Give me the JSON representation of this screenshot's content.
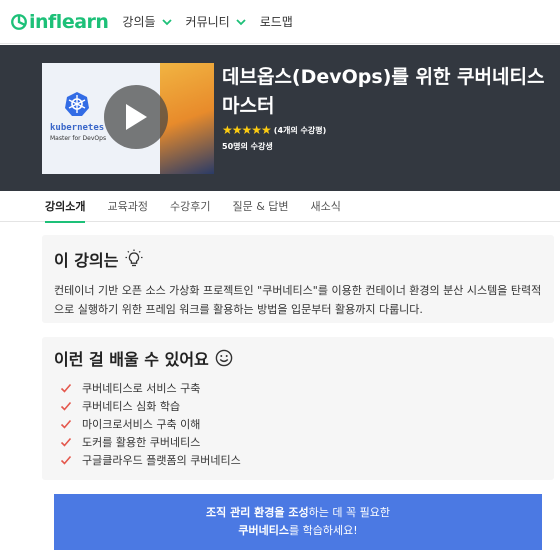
{
  "nav": {
    "logo": "inflearn",
    "items": [
      {
        "label": "강의들",
        "has_dropdown": true
      },
      {
        "label": "커뮤니티",
        "has_dropdown": true
      },
      {
        "label": "로드맵",
        "has_dropdown": false
      }
    ]
  },
  "course": {
    "thumbnail": {
      "name": "kubernetes",
      "subtitle": "Master for DevOps"
    },
    "title": "데브옵스(DevOps)를 위한 쿠버네티스 마스터",
    "stars": "★★★★★",
    "rating_text": "(4개의 수강평)",
    "students": "50명의 수강생"
  },
  "tabs": [
    "강의소개",
    "교육과정",
    "수강후기",
    "질문 & 답변",
    "새소식"
  ],
  "active_tab": 0,
  "intro": {
    "title": "이 강의는",
    "title_icon": "lightbulb-icon",
    "description": "컨테이너 기반 오픈 소스 가상화 프로젝트인 \"쿠버네티스\"를 이용한 컨테이너 환경의 분산 시스템을 탄력적으로 실행하기 위한 프레임 워크를 활용하는 방법을 입문부터 활용까지 다룹니다."
  },
  "learn": {
    "title": "이런 걸 배울 수 있어요",
    "title_icon": "smile-icon",
    "items": [
      "쿠버네티스로 서비스 구축",
      "쿠버네티스 심화 학습",
      "마이크로서비스 구축 이해",
      "도커를 활용한 쿠버네티스",
      "구글클라우드 플랫폼의 쿠버네티스"
    ]
  },
  "banner": {
    "line1_bold": "조직 관리 환경을 조성",
    "line1_rest": "하는 데 꼭 필요한",
    "line2_bold": "쿠버네티스",
    "line2_rest": "를 학습하세요!"
  },
  "colors": {
    "brand": "#1dc078",
    "hero_bg": "#333840",
    "banner_bg": "#4b79e3",
    "check": "#e4574c",
    "star": "#fdcc11"
  }
}
